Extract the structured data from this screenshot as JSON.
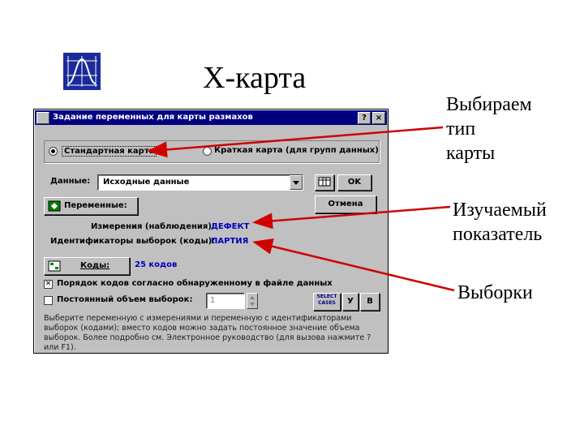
{
  "slide": {
    "title": "X-карта",
    "annotations": [
      "Выбираем тип карты",
      "Изучаемый показатель",
      "Выборки"
    ],
    "annotation1_lines": [
      "Выбираем",
      "тип",
      "карты"
    ],
    "annotation2_lines": [
      "Изучаемый",
      "показатель"
    ],
    "annotation3_lines": [
      "Выборки"
    ],
    "arrow_color": "#d00000"
  },
  "dialog": {
    "title": "Задание переменных для карты размахов",
    "help_btn": "?",
    "close_btn": "×",
    "radio_standard": "Стандартная карта",
    "radio_short": "Краткая карта (для групп данных)",
    "data_label": "Данные:",
    "data_value": "Исходные данные",
    "ok_label": "OK",
    "cancel_label": "Отмена",
    "variables_label": "Переменные:",
    "measurements_label": "Измерения (наблюдения):",
    "measurements_value": "ДЕФЕКТ",
    "identifiers_label": "Идентификаторы выборок (коды):",
    "identifiers_value": "ПАРТИЯ",
    "codes_label": "Коды:",
    "codes_value": "25 кодов",
    "order_checkbox": "Порядок кодов согласно обнаруженному в файле данных",
    "constant_checkbox": "Постоянный объем выборок:",
    "constant_value": "1",
    "select_cases": "SELECT CASES",
    "btn_y": "У",
    "btn_v": "В",
    "help_text": "Выберите переменную с измерениями и переменную с идентификаторами выборок (кодами); вместо кодов можно задать постоянное значение объема выборок. Более подробно см. Электронное руководство (для вызова нажмите ? или F1)."
  }
}
